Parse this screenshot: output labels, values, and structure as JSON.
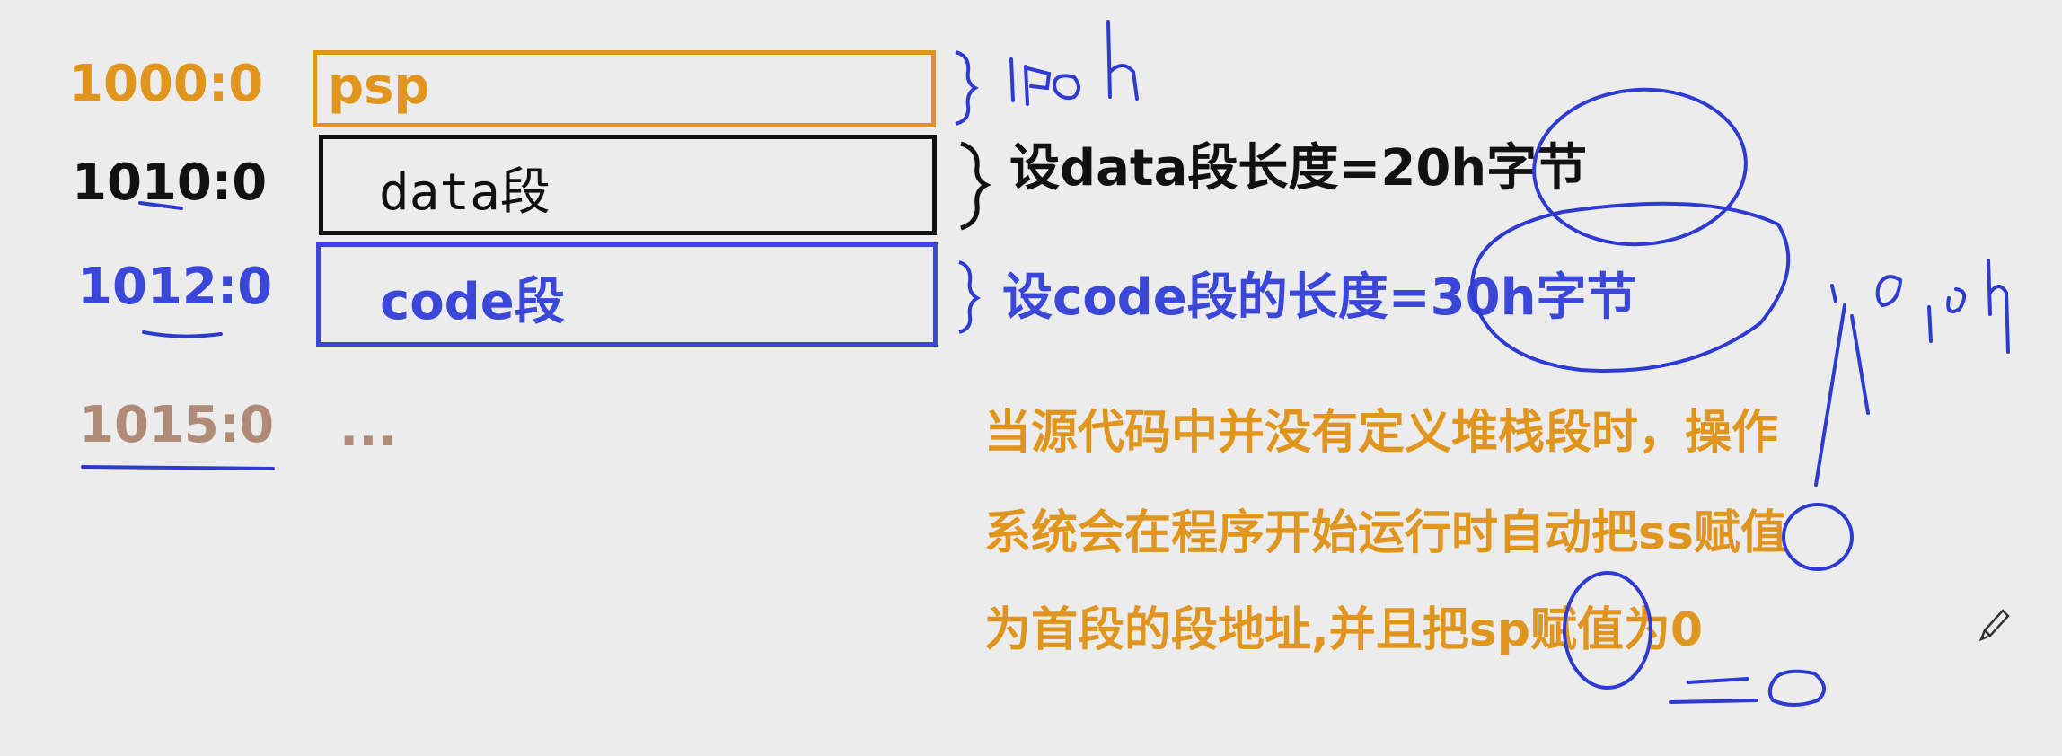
{
  "colors": {
    "orange": "#e0961e",
    "black": "#111111",
    "blue": "#3a47d8",
    "tan": "#b08c78",
    "ink_blue": "#2f3bd0",
    "background": "#ececec"
  },
  "rows": [
    {
      "address": "1000:0",
      "segment": "psp",
      "color": "#e0961e"
    },
    {
      "address": "1010:0",
      "segment": "data段",
      "color": "#111111"
    },
    {
      "address": "1012:0",
      "segment": "code段",
      "color": "#3a47d8"
    },
    {
      "address": "1015:0",
      "segment": "...",
      "color": "#b08c78"
    }
  ],
  "notes": {
    "data_length": "设data段长度=20h字节",
    "code_length": "设code段的长度=30h字节",
    "explanation_lines": [
      "当源代码中并没有定义堆栈段时，操作",
      "系统会在程序开始运行时自动把ss赋值",
      "为首段的段地址,并且把sp赋值为0"
    ]
  },
  "handwriting": {
    "psp_size": "100h",
    "ss_value": "1010h",
    "sp_value": "=0"
  },
  "icons": [
    "pencil-cursor-icon"
  ]
}
